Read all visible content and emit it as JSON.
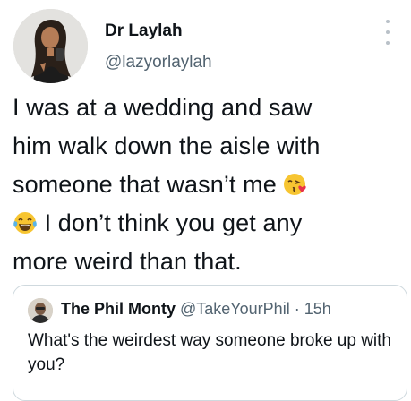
{
  "author": {
    "display_name": "Dr Laylah",
    "handle": "@lazyorlaylah",
    "avatar_icon": "profile-photo"
  },
  "more_icon": "more-vertical-icon",
  "tweet": {
    "line1": "I was at a  wedding and saw",
    "line2": "him walk down the aisle with",
    "line3": "someone that wasn’t me",
    "line4": "I don’t think you get any",
    "line5": "more weird than that.",
    "emoji_1": "face-blowing-kiss-emoji",
    "emoji_2": "face-with-tears-of-joy-emoji"
  },
  "quoted_tweet": {
    "display_name": "The Phil Monty",
    "handle": "@TakeYourPhil",
    "separator": "·",
    "time": "15h",
    "text": "What's the weirdest way someone broke up with you?"
  },
  "colors": {
    "text": "#0f1419",
    "secondary_text": "#536471",
    "border": "#cfd9de",
    "emoji_yellow": "#f7c531",
    "emoji_heart": "#e8334a",
    "emoji_tear": "#5ab4e8"
  }
}
